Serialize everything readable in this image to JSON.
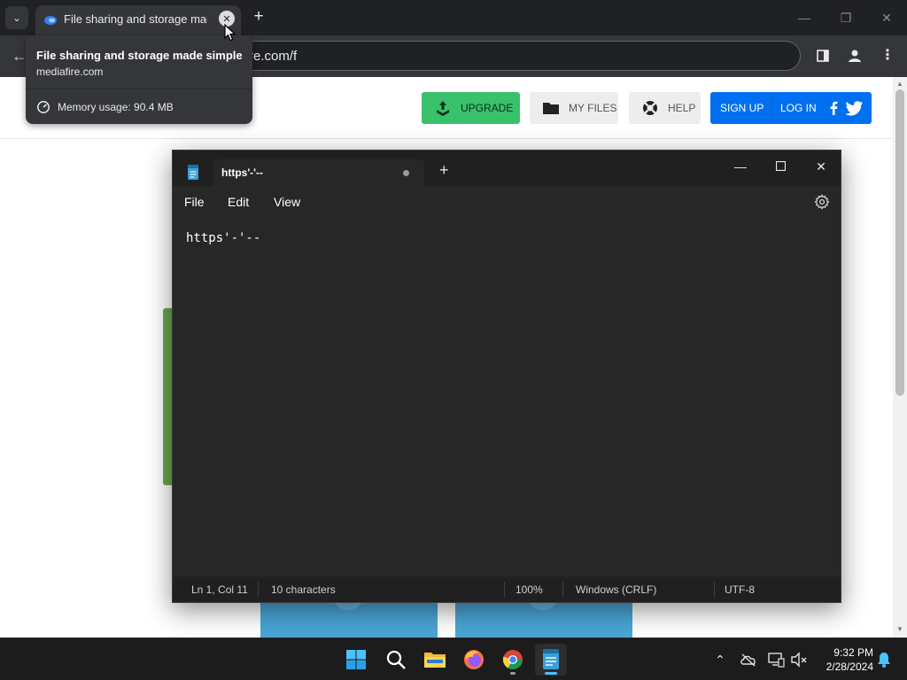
{
  "browser": {
    "tab": {
      "title": "File sharing and storage made simple",
      "close_symbol": "✕"
    },
    "new_tab_symbol": "+",
    "address_bar": {
      "url": "re.com/f"
    },
    "hover_card": {
      "title": "File sharing and storage made simple",
      "domain": "mediafire.com",
      "memory": "Memory usage: 90.4 MB"
    },
    "window_controls": {
      "minimize": "—",
      "restore": "❐",
      "close": "✕"
    },
    "accent_color": "#35363a"
  },
  "webpage": {
    "nav": {
      "upgrade": "UPGRADE",
      "my_files": "MY FILES",
      "help": "HELP",
      "sign_up": "SIGN UP",
      "log_in": "LOG IN"
    },
    "colors": {
      "upgrade": "#39c16c",
      "auth": "#0070f0"
    }
  },
  "notepad": {
    "tab_title": "https'-'--",
    "menu": {
      "file": "File",
      "edit": "Edit",
      "view": "View"
    },
    "content": "https'-'--",
    "status": {
      "position": "Ln 1, Col 11",
      "characters": "10 characters",
      "zoom": "100%",
      "line_ending": "Windows (CRLF)",
      "encoding": "UTF-8"
    }
  },
  "taskbar": {
    "apps": [
      "start-icon",
      "search-icon",
      "file-explorer-icon",
      "firefox-icon",
      "chrome-icon",
      "notepad-icon"
    ],
    "clock": {
      "time": "9:32 PM",
      "date": "2/28/2024"
    }
  }
}
